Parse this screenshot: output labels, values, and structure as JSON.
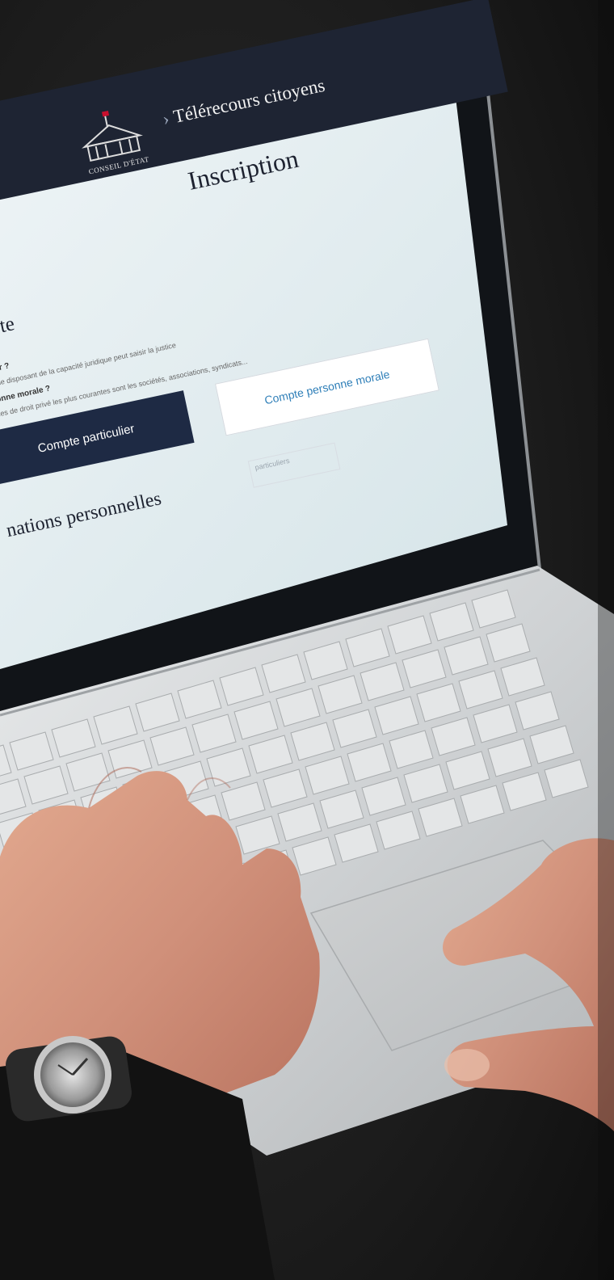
{
  "screen": {
    "logo_text": "CONSEIL D'ÉTAT",
    "site_title": "Télérecours citoyens",
    "page_title": "Inscription",
    "section_title": "ompte",
    "question_particulier": "rticulier ?",
    "desc_particulier": "physique disposant de la capacité juridique peut saisir la justice",
    "question_morale": "personne morale ?",
    "desc_morale": "morales de droit privé les plus courantes sont les sociétés, associations, syndicats...",
    "button_particulier": "Compte particulier",
    "button_morale": "Compte personne morale",
    "section2_title": "nations personnelles",
    "field_placeholder": "particuliers"
  },
  "colors": {
    "screen_header": "#1e2433",
    "primary_button": "#1e2a44",
    "link_blue": "#2f7fb8",
    "background_dark": "#161616",
    "laptop_silver": "#c9cbcd"
  }
}
